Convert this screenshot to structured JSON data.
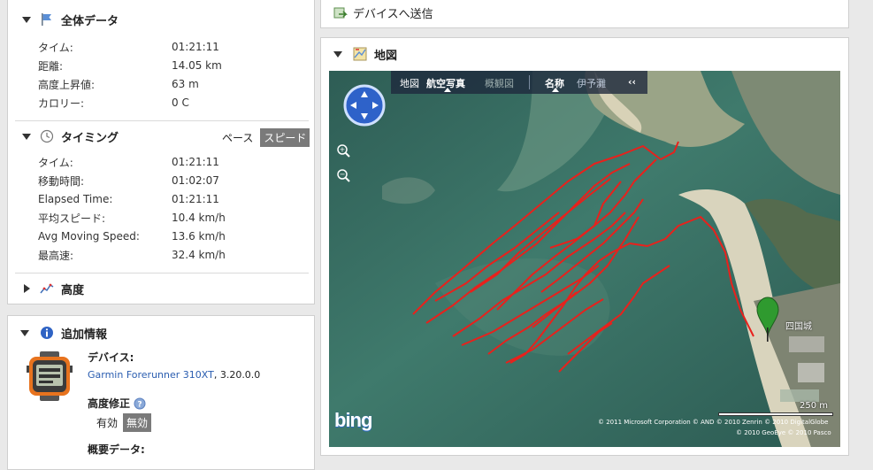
{
  "overall": {
    "title": "全体データ",
    "rows": [
      {
        "label": "タイム:",
        "value": "01:21:11"
      },
      {
        "label": "距離:",
        "value": "14.05 km"
      },
      {
        "label": "高度上昇値:",
        "value": "63 m"
      },
      {
        "label": "カロリー:",
        "value": "0 C"
      }
    ]
  },
  "timing": {
    "title": "タイミング",
    "toggle": {
      "pace": "ペース",
      "speed": "スピード"
    },
    "rows": [
      {
        "label": "タイム:",
        "value": "01:21:11"
      },
      {
        "label": "移動時間:",
        "value": "01:02:07"
      },
      {
        "label": "Elapsed Time:",
        "value": "01:21:11"
      },
      {
        "label": "平均スピード:",
        "value": "10.4 km/h"
      },
      {
        "label": "Avg Moving Speed:",
        "value": "13.6 km/h"
      },
      {
        "label": "最高速:",
        "value": "32.4 km/h"
      }
    ]
  },
  "elevation": {
    "title": "高度"
  },
  "extra": {
    "title": "追加情報",
    "device_label": "デバイス:",
    "device_link": "Garmin Forerunner 310XT",
    "device_version": ", 3.20.0.0",
    "elev_corr_label": "高度修正",
    "elev_opts": {
      "on": "有効",
      "off": "無効"
    },
    "summary_label": "概要データ:"
  },
  "send": {
    "label": "デバイスへ送信"
  },
  "map": {
    "title": "地図",
    "bar": {
      "map": "地図",
      "aerial": "航空写真",
      "bird": "概観図",
      "labels": "名称",
      "place": "伊予灘",
      "collapse": "‹‹"
    },
    "zoom_in": "+",
    "zoom_out": "−",
    "scale": "250 m",
    "place_label": "四国城",
    "copyright1": "© 2011 Microsoft Corporation   © AND   © 2010 Zenrin   © 2010 DigitalGlobe",
    "copyright2": "© 2010 GeoEye   © 2010 Pasco",
    "logo": "bing"
  },
  "colors": {
    "track": "#e8211c",
    "link": "#2a5db0",
    "toggle_active": "#7a7a7a"
  }
}
